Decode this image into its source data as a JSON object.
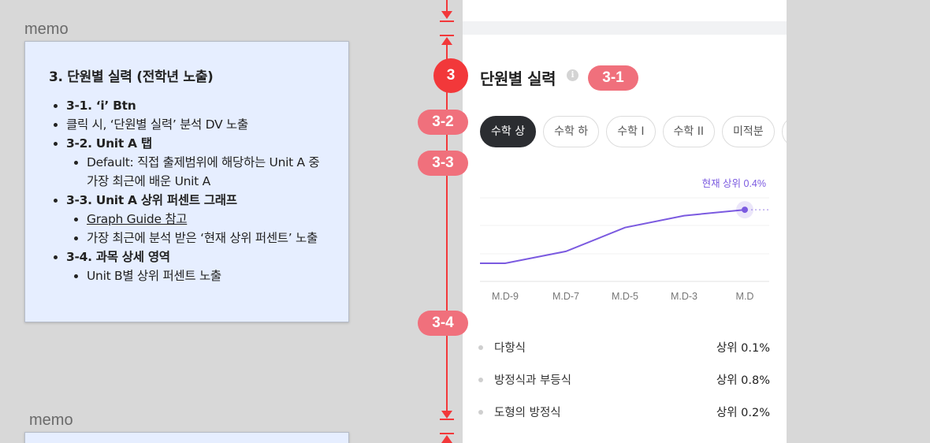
{
  "memos": [
    {
      "label": "memo",
      "title": "3. 단원별 실력 (전학년 노출)",
      "items": [
        {
          "text": "3-1.  ‘i’ Btn",
          "level": 0,
          "bold": true
        },
        {
          "text": "클릭 시, ‘단원별 실력’ 분석 DV 노출",
          "level": 0,
          "bold": false
        },
        {
          "text": "3-2. Unit A 탭",
          "level": 0,
          "bold": true
        },
        {
          "text": "Default: 직접 출제범위에 해당하는 Unit A 중 가장 최근에 배운 Unit A",
          "level": 1,
          "bold": false
        },
        {
          "text": "3-3. Unit A 상위 퍼센트 그래프",
          "level": 0,
          "bold": true
        },
        {
          "text": "Graph Guide 참고",
          "level": 1,
          "bold": false,
          "underline": true
        },
        {
          "text": "가장 최근에 분석 받은 ‘현재 상위 퍼센트’ 노출",
          "level": 1,
          "bold": false
        },
        {
          "text": "3-4. 과목 상세 영역",
          "level": 0,
          "bold": true
        },
        {
          "text": "Unit B별 상위 퍼센트 노출",
          "level": 1,
          "bold": false
        }
      ]
    },
    {
      "label": "memo"
    }
  ],
  "section": {
    "title": "단원별 실력",
    "info_icon": "info-icon",
    "tabs": [
      {
        "label": "수학 상",
        "active": true
      },
      {
        "label": "수학 하",
        "active": false
      },
      {
        "label": "수학 I",
        "active": false
      },
      {
        "label": "수학 II",
        "active": false
      },
      {
        "label": "미적분",
        "active": false
      },
      {
        "label": "",
        "active": false
      }
    ]
  },
  "chart_data": {
    "type": "line",
    "x": [
      "",
      "M.D-9",
      "M.D-7",
      "M.D-5",
      "M.D-3",
      "M.D"
    ],
    "series": [
      {
        "values": [
          0.0,
          0.0,
          0.1,
          0.3,
          0.4,
          0.45
        ]
      }
    ],
    "x_tick_labels": [
      "M.D-9",
      "M.D-7",
      "M.D-5",
      "M.D-3",
      "M.D"
    ],
    "annotation": "현재 상위 0.4%",
    "line_color": "#7b5ae0",
    "grid": true
  },
  "subjects": [
    {
      "name": "다항식",
      "value": "상위 0.1%"
    },
    {
      "name": "방정식과 부등식",
      "value": "상위 0.8%"
    },
    {
      "name": "도형의 방정식",
      "value": "상위 0.2%"
    }
  ],
  "annotations": {
    "main": "3",
    "info": "3-1",
    "tabs": "3-2",
    "graph": "3-3",
    "detail": "3-4"
  },
  "colors": {
    "annotation_red": "#f2383a",
    "annotation_pink": "#f0707c",
    "accent_purple": "#7b5ae0",
    "memo_bg": "#e6eeff"
  }
}
